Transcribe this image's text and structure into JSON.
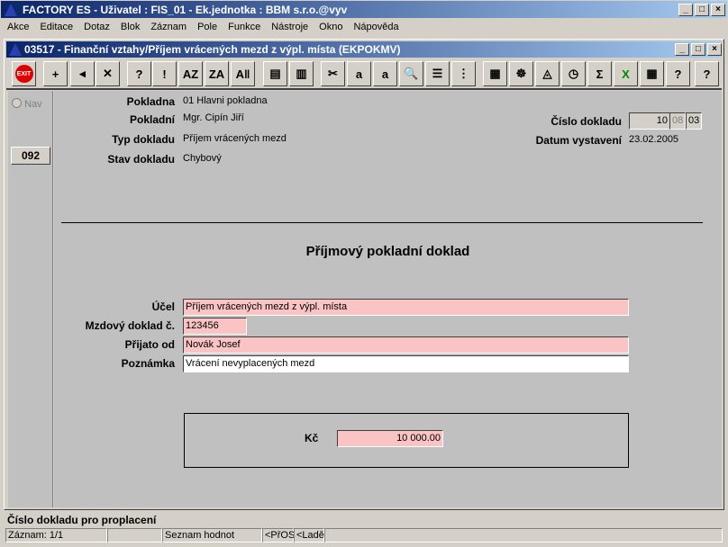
{
  "app": {
    "title": "FACTORY ES - Uživatel : FIS_01 - Ek.jednotka : BBM s.r.o.@vyv"
  },
  "menu": [
    "Akce",
    "Editace",
    "Dotaz",
    "Blok",
    "Záznam",
    "Pole",
    "Funkce",
    "Nástroje",
    "Okno",
    "Nápověda"
  ],
  "child": {
    "title": "03517 - Finanční vztahy/Příjem vrácených mezd z výpl. místa (EKPOKMV)"
  },
  "toolbar": [
    {
      "icon": "exit-icon",
      "glyph": "EXIT"
    },
    {
      "icon": "insert-record-icon",
      "glyph": "+"
    },
    {
      "icon": "save-icon",
      "glyph": "◂"
    },
    {
      "icon": "delete-record-icon",
      "glyph": "✕"
    },
    {
      "icon": "query-enter-icon",
      "glyph": "?"
    },
    {
      "icon": "query-execute-icon",
      "glyph": "!"
    },
    {
      "icon": "sort-asc-icon",
      "glyph": "AZ"
    },
    {
      "icon": "sort-desc-icon",
      "glyph": "ZA"
    },
    {
      "icon": "sort-multi-icon",
      "glyph": "A‖"
    },
    {
      "icon": "print-icon",
      "glyph": "▤"
    },
    {
      "icon": "print-multi-icon",
      "glyph": "▥"
    },
    {
      "icon": "cut-icon",
      "glyph": "✂"
    },
    {
      "icon": "copy-icon",
      "glyph": "a"
    },
    {
      "icon": "paste-icon",
      "glyph": "a"
    },
    {
      "icon": "zoom-search-icon",
      "glyph": "🔍"
    },
    {
      "icon": "list-icon",
      "glyph": "☰"
    },
    {
      "icon": "columns-icon",
      "glyph": "⋮"
    },
    {
      "icon": "form-icon",
      "glyph": "▦"
    },
    {
      "icon": "wheel-icon",
      "glyph": "☸"
    },
    {
      "icon": "eye-icon",
      "glyph": "◬"
    },
    {
      "icon": "clock-icon",
      "glyph": "◷"
    },
    {
      "icon": "sum-icon",
      "glyph": "Σ"
    },
    {
      "icon": "excel-icon",
      "glyph": "X"
    },
    {
      "icon": "calendar-icon",
      "glyph": "▦"
    },
    {
      "icon": "help-context-icon",
      "glyph": "?"
    },
    {
      "icon": "help-icon",
      "glyph": "?"
    }
  ],
  "nav": {
    "radio_label": "Nav",
    "button": "092"
  },
  "header": {
    "pokladna_label": "Pokladna",
    "pokladna": "01 Hlavni pokladna",
    "pokladni_label": "Pokladní",
    "pokladni": "Mgr. Cipín Jiří",
    "typ_label": "Typ dokladu",
    "typ": "Příjem vrácených mezd",
    "stav_label": "Stav dokladu",
    "stav": "Chybový",
    "cislo_label": "Číslo dokladu",
    "cislo_1": "10",
    "cislo_2": "08",
    "cislo_3": "03",
    "datum_label": "Datum vystavení",
    "datum": "23.02.2005"
  },
  "form": {
    "heading": "Příjmový pokladní doklad",
    "ucel_label": "Účel",
    "ucel": "Příjem vrácených mezd z výpl. místa",
    "mzdovy_label": "Mzdový doklad č.",
    "mzdovy": "123456",
    "prijato_label": "Přijato od",
    "prijato": "Novák Josef",
    "poznamka_label": "Poznámka",
    "poznamka": "Vrácení nevyplacených mezd",
    "kc_label": "Kč",
    "kc": "10 000.00"
  },
  "status": {
    "hint": "Číslo dokladu pro proplacení",
    "record": "Záznam: 1/1",
    "empty": "",
    "list": "Seznam hodnot",
    "c1": "<PřOS",
    "c2": "<Ladě",
    "c3": ""
  },
  "colors": {
    "title": "#0a246a",
    "required_field": "#fbc4c4"
  }
}
